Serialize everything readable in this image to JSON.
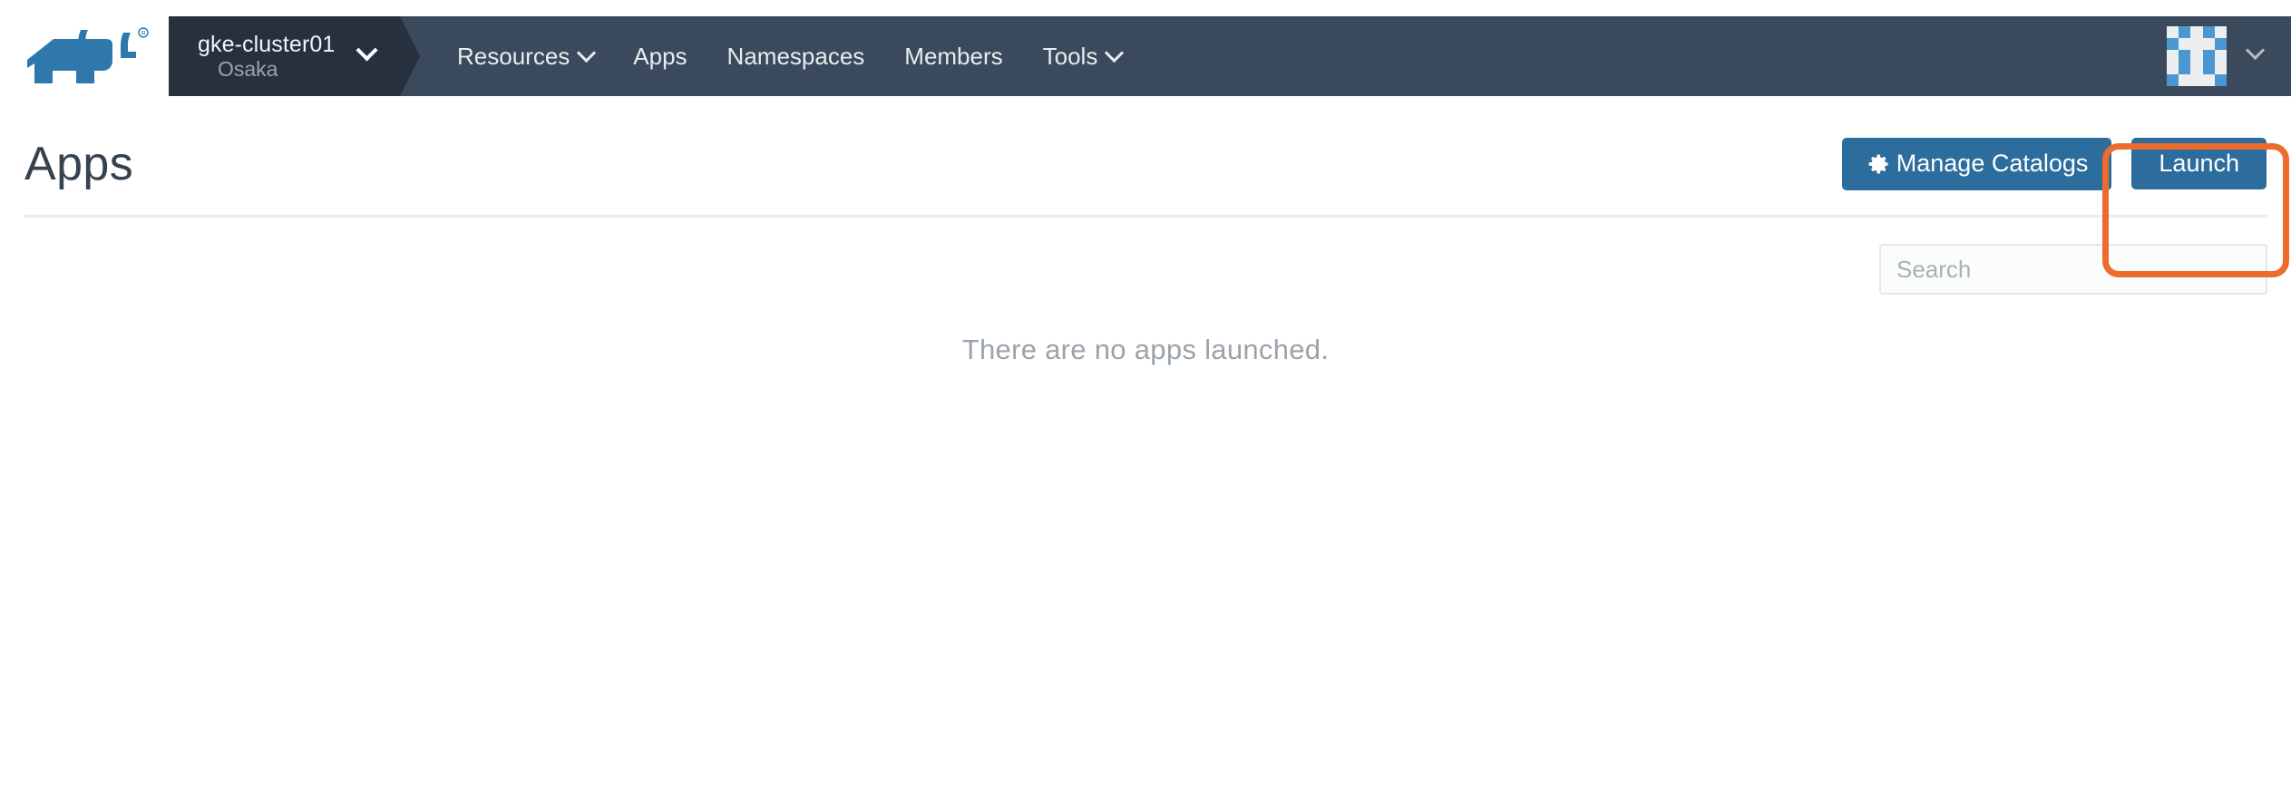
{
  "header": {
    "logo": "rancher-cow-logo",
    "cluster": {
      "name": "gke-cluster01",
      "location": "Osaka",
      "caret": "chevron-down-icon"
    },
    "nav_items": [
      {
        "label": "Resources",
        "caret": "chevron-down-icon",
        "has_caret": true
      },
      {
        "label": "Apps",
        "has_caret": false
      },
      {
        "label": "Namespaces",
        "has_caret": false
      },
      {
        "label": "Members",
        "has_caret": false
      },
      {
        "label": "Tools",
        "caret": "chevron-down-icon",
        "has_caret": true
      }
    ],
    "user": {
      "avatar": "identicon-avatar",
      "caret": "chevron-down-icon"
    }
  },
  "page": {
    "title": "Apps",
    "manage_catalogs_label": "Manage Catalogs",
    "manage_catalogs_icon": "gear-icon",
    "launch_label": "Launch",
    "search_placeholder": "Search",
    "search_value": "",
    "empty_message": "There are no apps launched."
  },
  "annotation": {
    "type": "highlight-box",
    "target": "launch-button",
    "color": "#ec6b2d"
  },
  "colors": {
    "nav_bg": "#3a4a5c",
    "cluster_bg": "#27313e",
    "primary_button": "#2c6d9e",
    "logo_blue": "#2e78ab",
    "accent_orange": "#ec6b2d",
    "title_text": "#37424f",
    "muted_text": "#9aa3ac"
  },
  "avatar_grid": [
    [
      0,
      1,
      0,
      1,
      0
    ],
    [
      1,
      0,
      0,
      0,
      1
    ],
    [
      0,
      1,
      0,
      1,
      0
    ],
    [
      0,
      1,
      0,
      1,
      0
    ],
    [
      1,
      0,
      0,
      0,
      1
    ]
  ]
}
